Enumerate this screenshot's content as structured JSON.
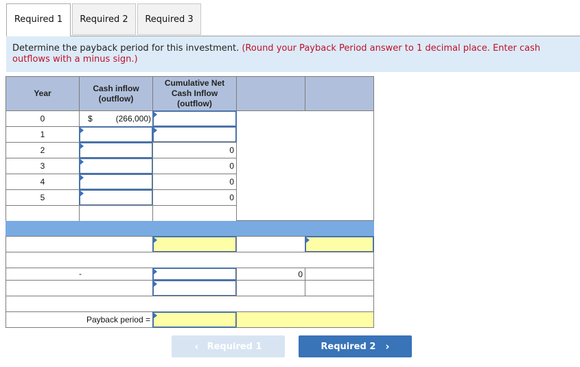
{
  "tabs": [
    {
      "label": "Required 1",
      "active": true
    },
    {
      "label": "Required 2",
      "active": false
    },
    {
      "label": "Required 3",
      "active": false
    }
  ],
  "instruction": {
    "text": "Determine the payback period for this investment.",
    "note": "(Round your Payback Period answer to 1 decimal place. Enter cash outflows with a minus sign.)"
  },
  "table": {
    "headers": {
      "year": "Year",
      "cash_inflow": "Cash inflow (outflow)",
      "cumulative": "Cumulative Net Cash Inflow (outflow)",
      "col4": "",
      "col5": ""
    },
    "rows": [
      {
        "year": "0",
        "currency": "$",
        "cash_inflow": "(266,000)",
        "cumulative": ""
      },
      {
        "year": "1",
        "cash_inflow": "",
        "cumulative": ""
      },
      {
        "year": "2",
        "cash_inflow": "",
        "cumulative": "0"
      },
      {
        "year": "3",
        "cash_inflow": "",
        "cumulative": "0"
      },
      {
        "year": "4",
        "cash_inflow": "",
        "cumulative": "0"
      },
      {
        "year": "5",
        "cash_inflow": "",
        "cumulative": "0"
      }
    ],
    "calc": {
      "row_a_input1": "",
      "row_a_input2": "",
      "row_c_dash": "-",
      "row_c_input": "",
      "row_c_value": "0",
      "row_d_input": "",
      "payback_label": "Payback period =",
      "payback_input": "",
      "payback_unit": ""
    }
  },
  "nav": {
    "prev_label": "Required 1",
    "next_label": "Required 2",
    "prev_icon": "chevron-left-icon",
    "next_icon": "chevron-right-icon"
  }
}
